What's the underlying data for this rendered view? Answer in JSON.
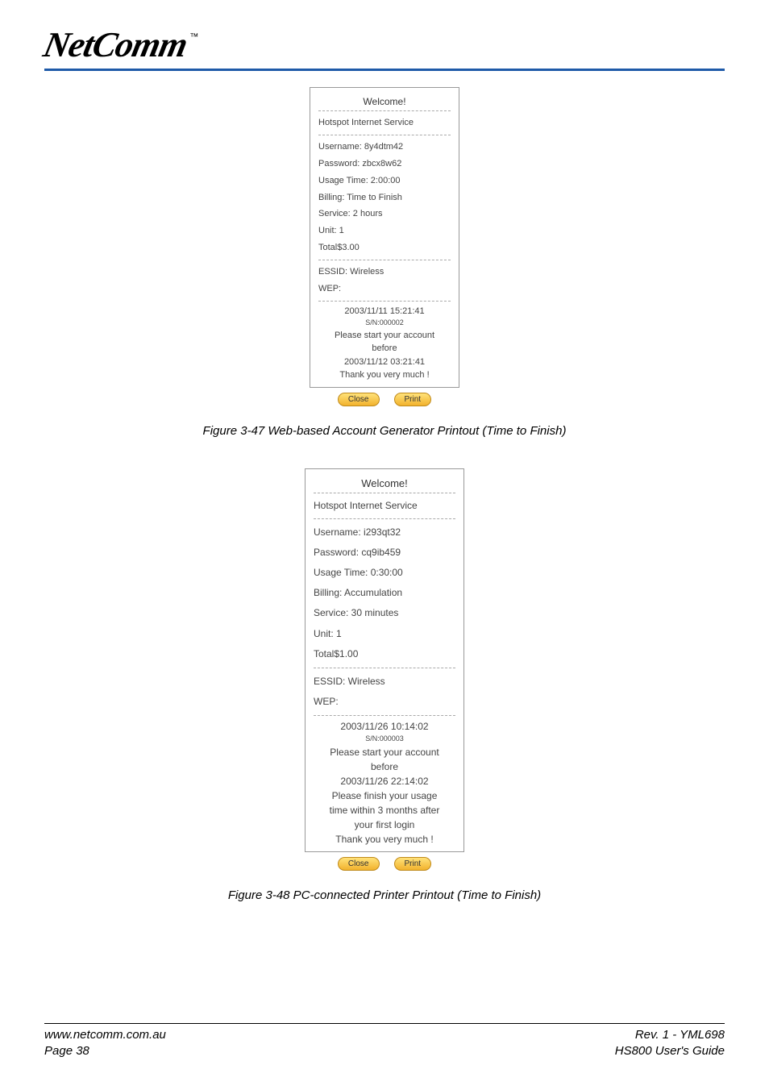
{
  "header": {
    "brand": "NetComm",
    "tm": "™"
  },
  "receipt1": {
    "welcome": "Welcome!",
    "service_title": "Hotspot Internet Service",
    "rows": {
      "username": "Username: 8y4dtm42",
      "password": "Password: zbcx8w62",
      "usage": "Usage Time: 2:00:00",
      "billing": "Billing: Time to Finish",
      "service": "Service: 2 hours",
      "unit": "Unit: 1",
      "total": "Total$3.00"
    },
    "wifi": {
      "essid": "ESSID: Wireless",
      "wep": "WEP:"
    },
    "footer": {
      "datetime": "2003/11/11 15:21:41",
      "sn": "S/N:000002",
      "start1": "Please start your account",
      "start2": "before",
      "deadline": "2003/11/12 03:21:41",
      "thanks": "Thank you very much !"
    },
    "buttons": {
      "close": "Close",
      "print": "Print"
    }
  },
  "caption1": "Figure 3-47 Web-based Account Generator Printout (Time to Finish)",
  "receipt2": {
    "welcome": "Welcome!",
    "service_title": "Hotspot Internet Service",
    "rows": {
      "username": "Username: i293qt32",
      "password": "Password: cq9ib459",
      "usage": "Usage Time: 0:30:00",
      "billing": "Billing: Accumulation",
      "service": "Service: 30 minutes",
      "unit": "Unit: 1",
      "total": "Total$1.00"
    },
    "wifi": {
      "essid": "ESSID: Wireless",
      "wep": "WEP:"
    },
    "footer": {
      "datetime": "2003/11/26 10:14:02",
      "sn": "S/N:000003",
      "start1": "Please start your account",
      "start2": "before",
      "deadline": "2003/11/26 22:14:02",
      "finish1": "Please finish your usage",
      "finish2": "time within 3 months after",
      "finish3": "your first login",
      "thanks": "Thank you very much !"
    },
    "buttons": {
      "close": "Close",
      "print": "Print"
    }
  },
  "caption2": "Figure 3-48 PC-connected Printer Printout (Time to Finish)",
  "page_footer": {
    "url": "www.netcomm.com.au",
    "rev": "Rev. 1 - YML698",
    "page": "Page 38",
    "guide": "HS800 User's Guide"
  }
}
